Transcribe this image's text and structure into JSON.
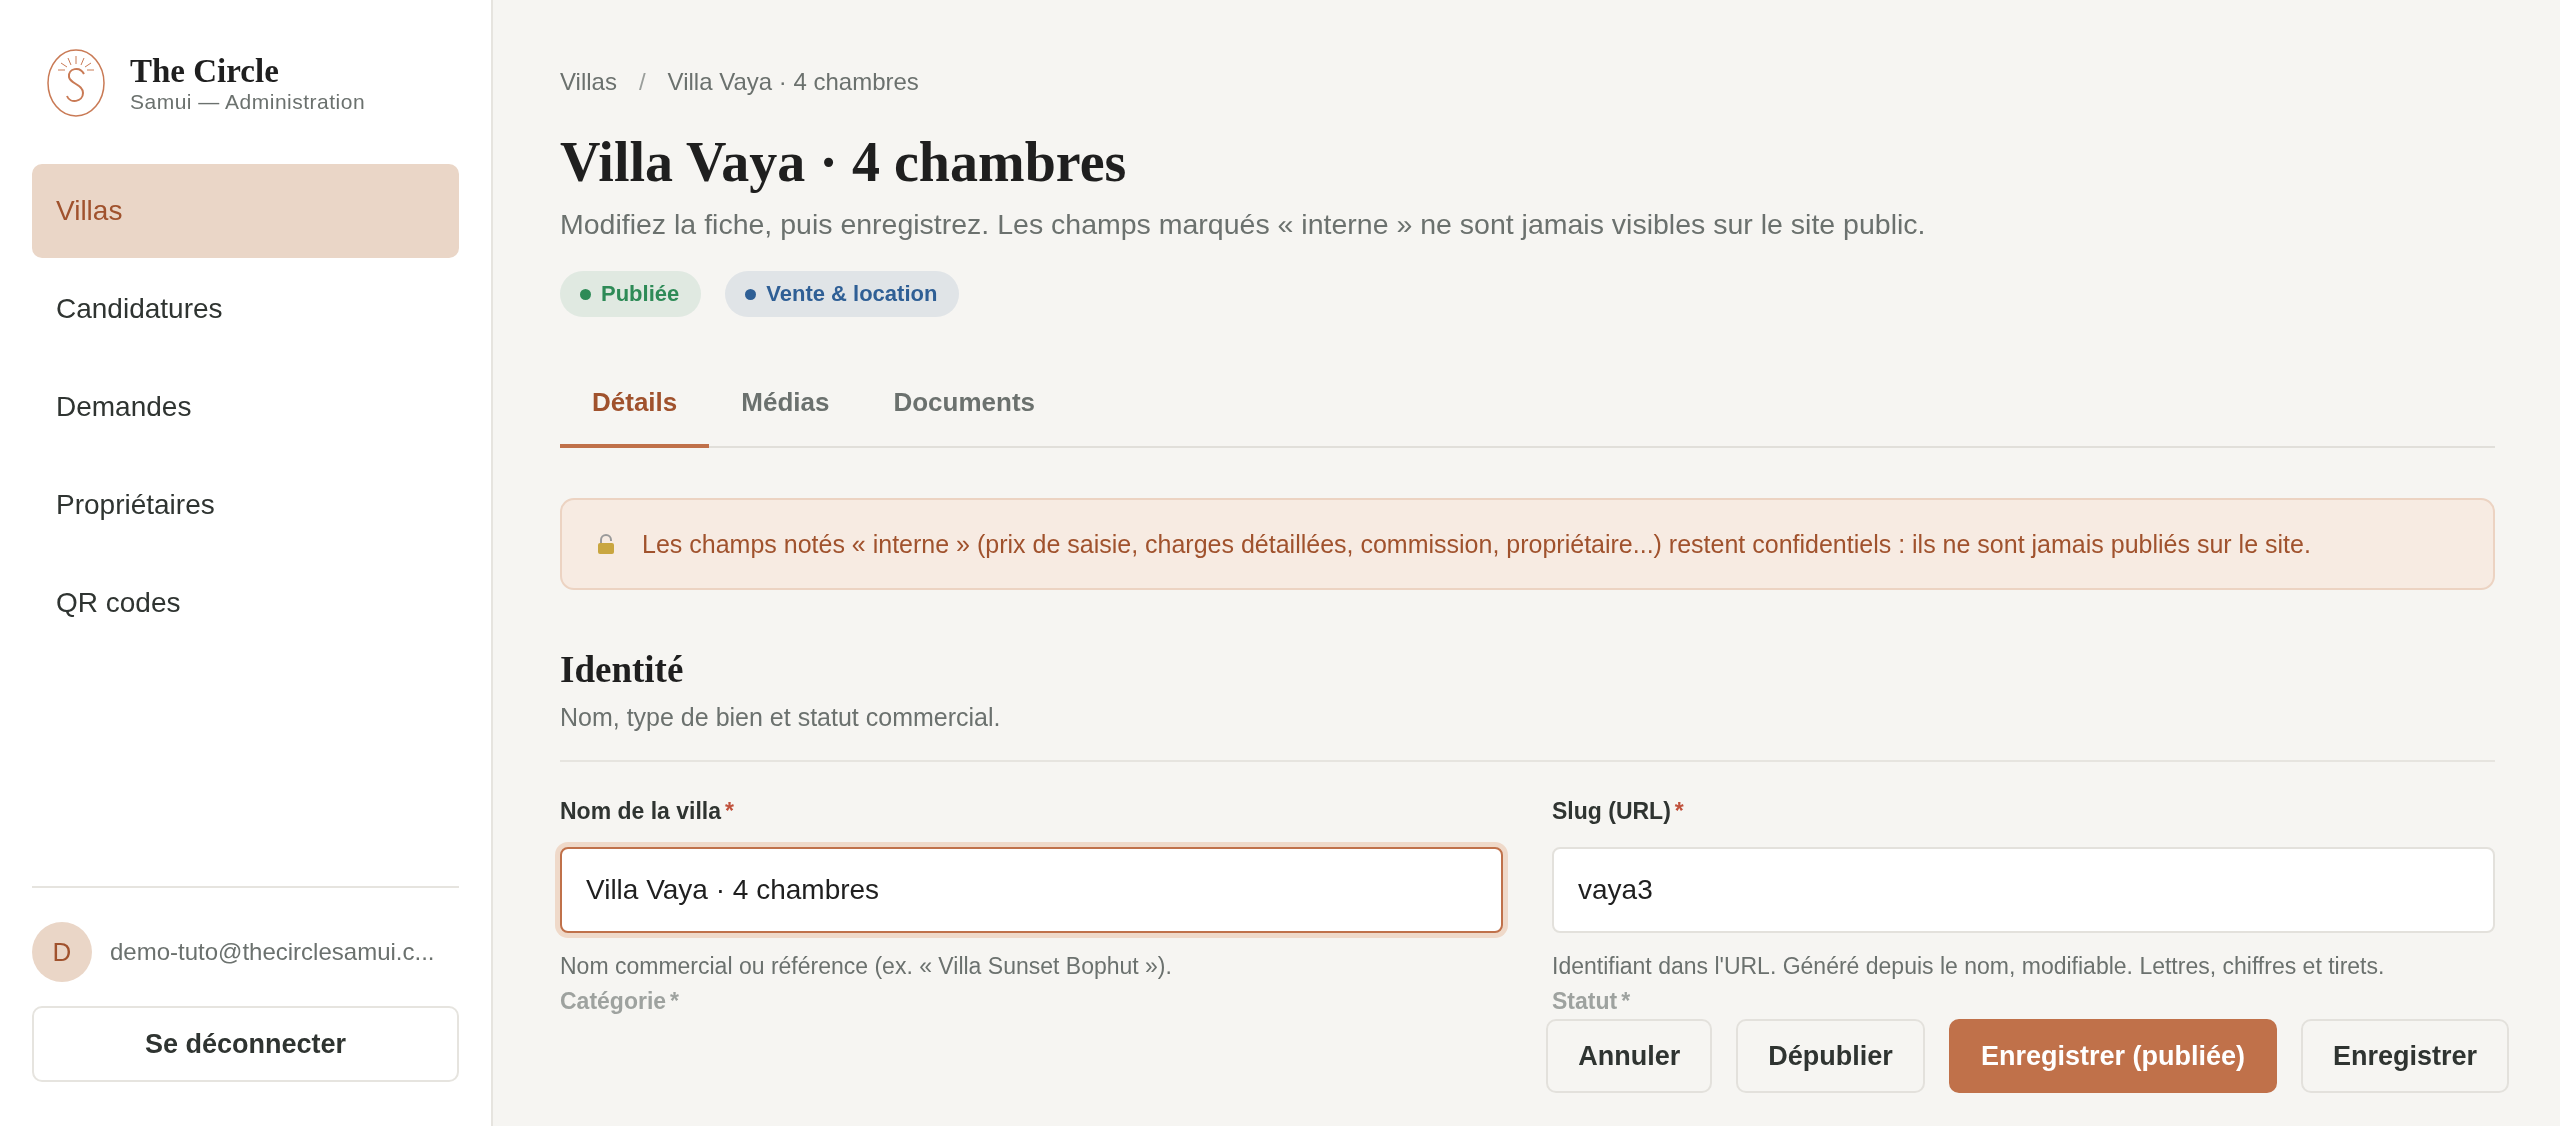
{
  "sidebar": {
    "brand": {
      "title": "The Circle",
      "subtitle": "Samui — Administration"
    },
    "items": [
      {
        "label": "Villas",
        "selected": true
      },
      {
        "label": "Candidatures",
        "selected": false
      },
      {
        "label": "Demandes",
        "selected": false
      },
      {
        "label": "Propriétaires",
        "selected": false
      },
      {
        "label": "QR codes",
        "selected": false
      }
    ],
    "user": {
      "initial": "D",
      "email": "demo-tuto@thecirclesamui.c..."
    },
    "logout": "Se déconnecter"
  },
  "breadcrumb": {
    "separator": "/",
    "items": [
      "Villas",
      "Villa Vaya · 4 chambres"
    ]
  },
  "title": "Villa Vaya · 4 chambres",
  "subtitle": "Modifiez la fiche, puis enregistrez. Les champs marqués « interne » ne sont jamais visibles sur le site public.",
  "badges": [
    {
      "label": "Publiée",
      "color": "#2e8b57"
    },
    {
      "label": "Vente & location",
      "color": "#2f5f95"
    }
  ],
  "tabs": [
    {
      "label": "Détails",
      "selected": true
    },
    {
      "label": "Médias",
      "selected": false
    },
    {
      "label": "Documents",
      "selected": false
    }
  ],
  "notice": "Les champs notés « interne » (prix de saisie, charges détaillées, commission, propriétaire...) restent confidentiels : ils ne sont jamais publiés sur le site.",
  "section": {
    "title": "Identité",
    "subtitle": "Nom, type de bien et statut commercial."
  },
  "fields": [
    {
      "label": "Nom de la villa",
      "required_mark": "*",
      "value": "Villa Vaya · 4 chambres",
      "hint": "Nom commercial ou référence (ex. « Villa Sunset Bophut »).",
      "focused": true
    },
    {
      "label": "Slug (URL)",
      "required_mark": "*",
      "value": "vaya3",
      "hint": "Identifiant dans l'URL. Généré depuis le nom, modifiable. Lettres, chiffres et tirets.",
      "focused": false
    }
  ],
  "faded_fields": [
    {
      "label": "Catégorie",
      "required_mark": "*"
    },
    {
      "label": "Statut",
      "required_mark": "*"
    }
  ],
  "actions": [
    {
      "label": "Annuler",
      "kind": "secondary"
    },
    {
      "label": "Dépublier",
      "kind": "secondary"
    },
    {
      "label": "Enregistrer (publiée)",
      "kind": "primary"
    },
    {
      "label": "Enregistrer",
      "kind": "secondary"
    }
  ]
}
